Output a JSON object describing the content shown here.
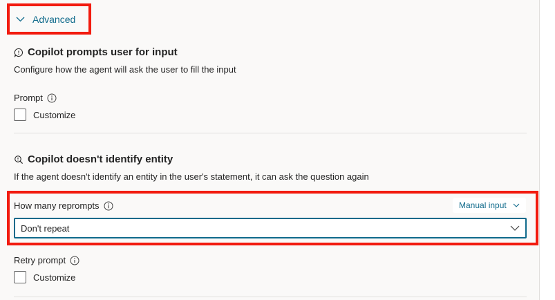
{
  "advanced": {
    "label": "Advanced"
  },
  "prompts_section": {
    "title": "Copilot prompts user for input",
    "description": "Configure how the agent will ask the user to fill the input",
    "prompt_label": "Prompt",
    "customize_label": "Customize"
  },
  "entity_section": {
    "title": "Copilot doesn't identify entity",
    "description": "If the agent doesn't identify an entity in the user's statement, it can ask the question again",
    "reprompts_label": "How many reprompts",
    "manual_input_label": "Manual input",
    "reprompts_value": "Don't repeat",
    "retry_label": "Retry prompt",
    "customize_label": "Customize"
  },
  "colors": {
    "accent": "#0f6a8b",
    "highlight": "#f21b0f",
    "background": "#faf9f8"
  },
  "icons": {
    "advanced": "chevron-down-icon",
    "prompts_section": "chat-bubble-icon",
    "entity_section": "search-icon",
    "info": "info-icon",
    "dropdown": "chevron-down-icon"
  }
}
